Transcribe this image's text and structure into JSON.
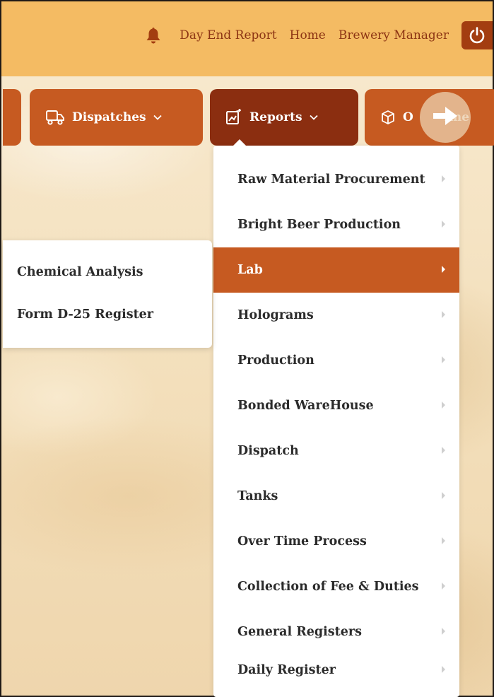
{
  "header": {
    "notification_icon": "bell-icon",
    "links": [
      "Day End Report",
      "Home",
      "Brewery Manager"
    ],
    "power_icon": "power-icon",
    "colors": {
      "bar": "#f4bb63",
      "link": "#8c3413",
      "power": "#a33d10"
    }
  },
  "menubar": {
    "items": [
      {
        "label": "Dispatches",
        "icon": "truck-icon",
        "chevron": "chevron-down-icon"
      },
      {
        "label": "Reports",
        "icon": "report-icon",
        "chevron": "chevron-down-icon",
        "active": true
      },
      {
        "label": "O",
        "label_tail": "ime",
        "icon": "box-icon"
      }
    ],
    "scroll_icon": "arrow-right-icon",
    "colors": {
      "button": "#c65a21",
      "active": "#8b2e10"
    }
  },
  "reports_menu": {
    "items": [
      {
        "label": "Raw Material Procurement"
      },
      {
        "label": "Bright Beer Production"
      },
      {
        "label": "Lab",
        "active": true
      },
      {
        "label": "Holograms"
      },
      {
        "label": "Production"
      },
      {
        "label": "Bonded WareHouse"
      },
      {
        "label": "Dispatch"
      },
      {
        "label": "Tanks"
      },
      {
        "label": "Over Time Process"
      },
      {
        "label": "Collection of Fee & Duties"
      },
      {
        "label": "General Registers"
      },
      {
        "label": "Daily Register"
      }
    ]
  },
  "lab_submenu": {
    "items": [
      {
        "label": "Chemical Analysis"
      },
      {
        "label": "Form D-25 Register"
      }
    ]
  }
}
